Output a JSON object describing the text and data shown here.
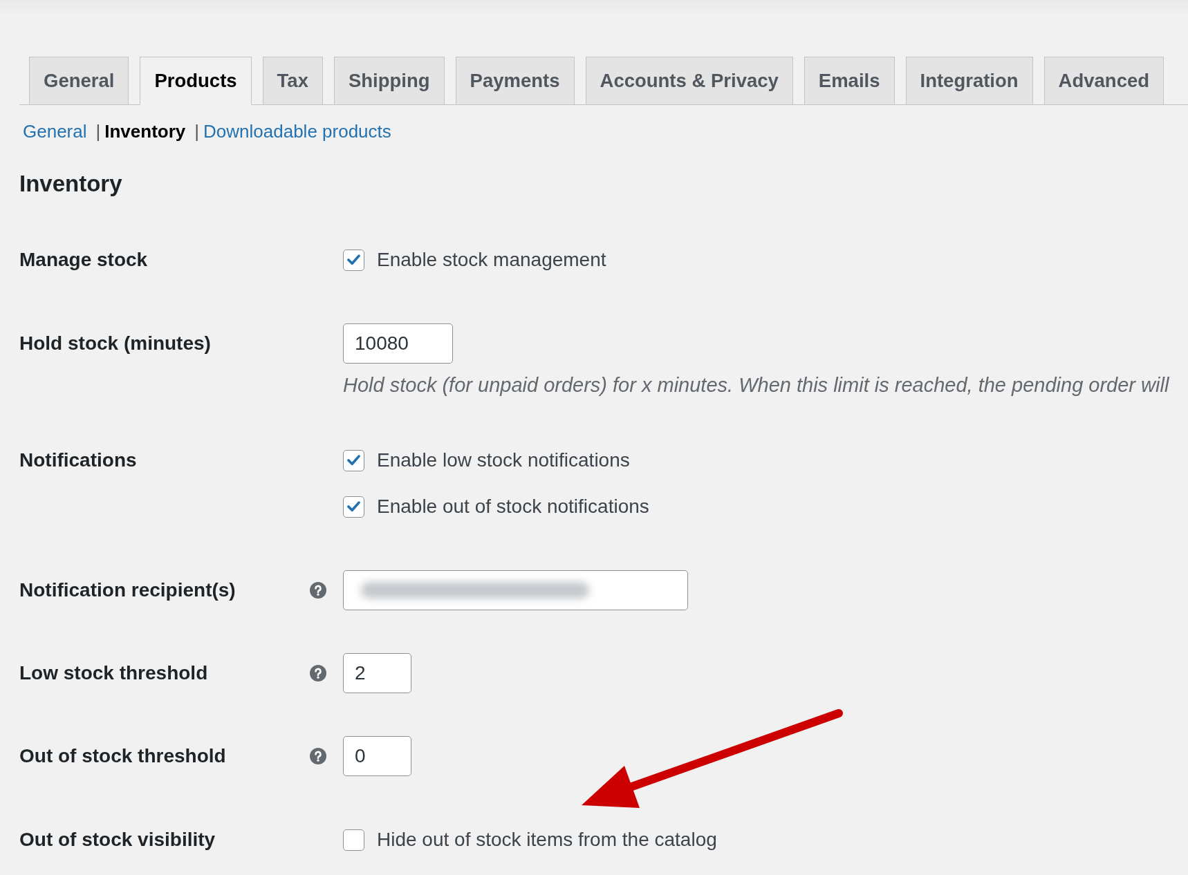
{
  "tabs": [
    {
      "label": "General",
      "selected": false
    },
    {
      "label": "Products",
      "selected": true
    },
    {
      "label": "Tax",
      "selected": false
    },
    {
      "label": "Shipping",
      "selected": false
    },
    {
      "label": "Payments",
      "selected": false
    },
    {
      "label": "Accounts & Privacy",
      "selected": false
    },
    {
      "label": "Emails",
      "selected": false
    },
    {
      "label": "Integration",
      "selected": false
    },
    {
      "label": "Advanced",
      "selected": false
    }
  ],
  "subnav": {
    "items": [
      {
        "label": "General",
        "selected": false
      },
      {
        "separator": "|",
        "label": "Inventory",
        "selected": true
      },
      {
        "separator": "|",
        "label": "Downloadable products",
        "selected": false
      }
    ]
  },
  "section_title": "Inventory",
  "rows": [
    {
      "kind": "checkboxes",
      "label": "Manage stock",
      "help": false,
      "options": [
        {
          "label": "Enable stock management",
          "checked": true
        }
      ]
    },
    {
      "kind": "duration",
      "label": "Hold stock (minutes)",
      "help": false,
      "value": "10080",
      "description": "Hold stock (for unpaid orders) for x minutes. When this limit is reached, the pending order will"
    },
    {
      "kind": "checkboxes",
      "label": "Notifications",
      "help": false,
      "options": [
        {
          "label": "Enable low stock notifications",
          "checked": true
        },
        {
          "label": "Enable out of stock notifications",
          "checked": true
        }
      ]
    },
    {
      "kind": "email",
      "label": "Notification recipient(s)",
      "help": true,
      "redacted": true
    },
    {
      "kind": "number",
      "label": "Low stock threshold",
      "help": true,
      "value": "2"
    },
    {
      "kind": "number",
      "label": "Out of stock threshold",
      "help": true,
      "value": "0"
    },
    {
      "kind": "checkboxes",
      "label": "Out of stock visibility",
      "help": false,
      "options": [
        {
          "label": "Hide out of stock items from the catalog",
          "checked": false
        }
      ]
    }
  ],
  "annotation": {
    "kind": "arrow"
  }
}
